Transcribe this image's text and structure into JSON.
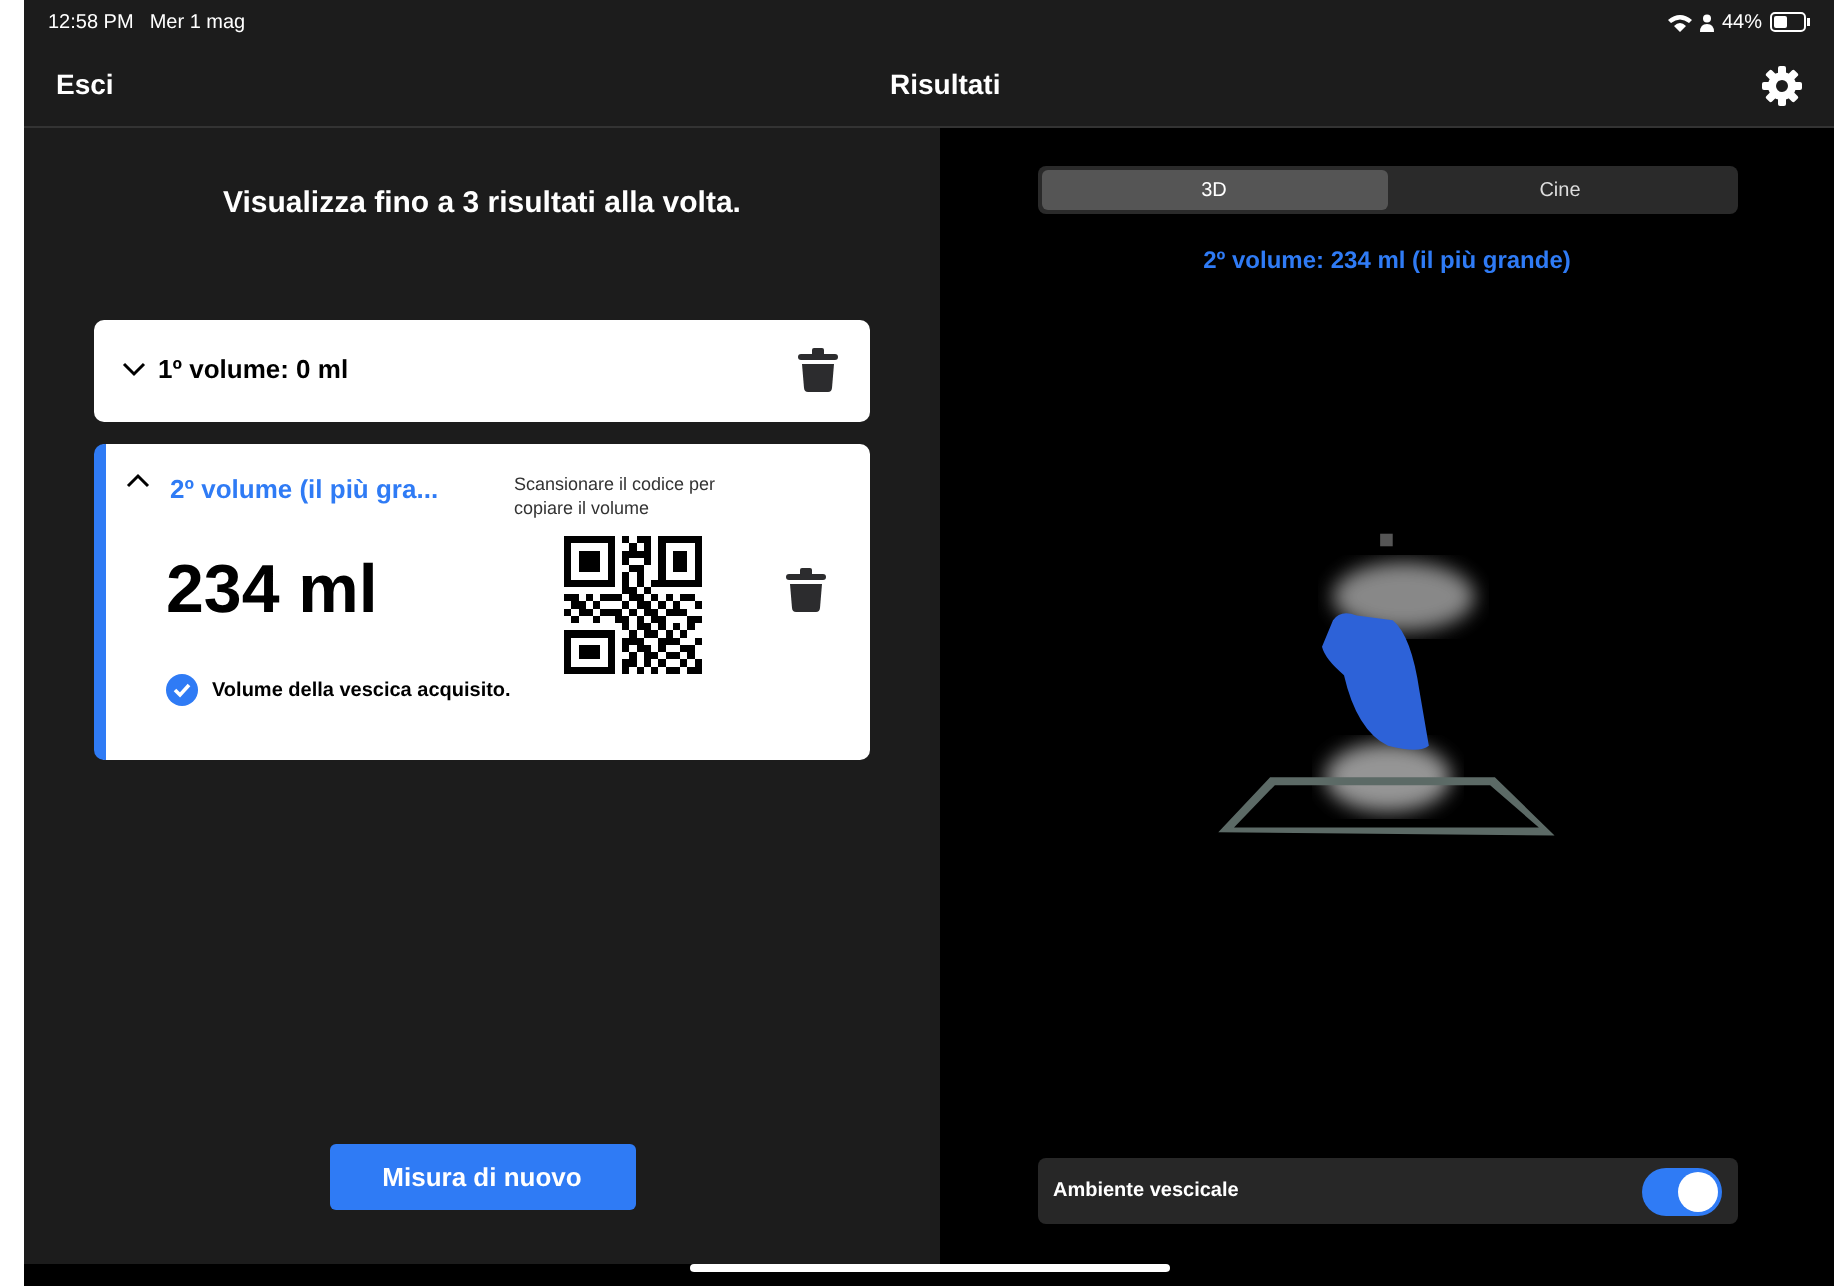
{
  "status_bar": {
    "time": "12:58 PM",
    "date": "Mer 1 mag",
    "battery": "44%"
  },
  "header": {
    "back": "Esci",
    "title": "Risultati"
  },
  "instruction": "Visualizza fino a 3 risultati alla volta.",
  "results": [
    {
      "title": "1º volume: 0 ml",
      "expanded": false
    },
    {
      "title": "2º volume (il più gra...",
      "expanded": true,
      "volume": "234 ml",
      "qr_caption": "Scansionare il codice per copiare il volume",
      "status": "Volume della vescica acquisito.",
      "acquired": true
    }
  ],
  "measure_button": "Misura di nuovo",
  "tabs": [
    {
      "label": "3D",
      "selected": true
    },
    {
      "label": "Cine",
      "selected": false
    }
  ],
  "view_title": "2º volume: 234 ml (il più grande)",
  "toggle": {
    "label": "Ambiente vescicale",
    "on": true
  }
}
